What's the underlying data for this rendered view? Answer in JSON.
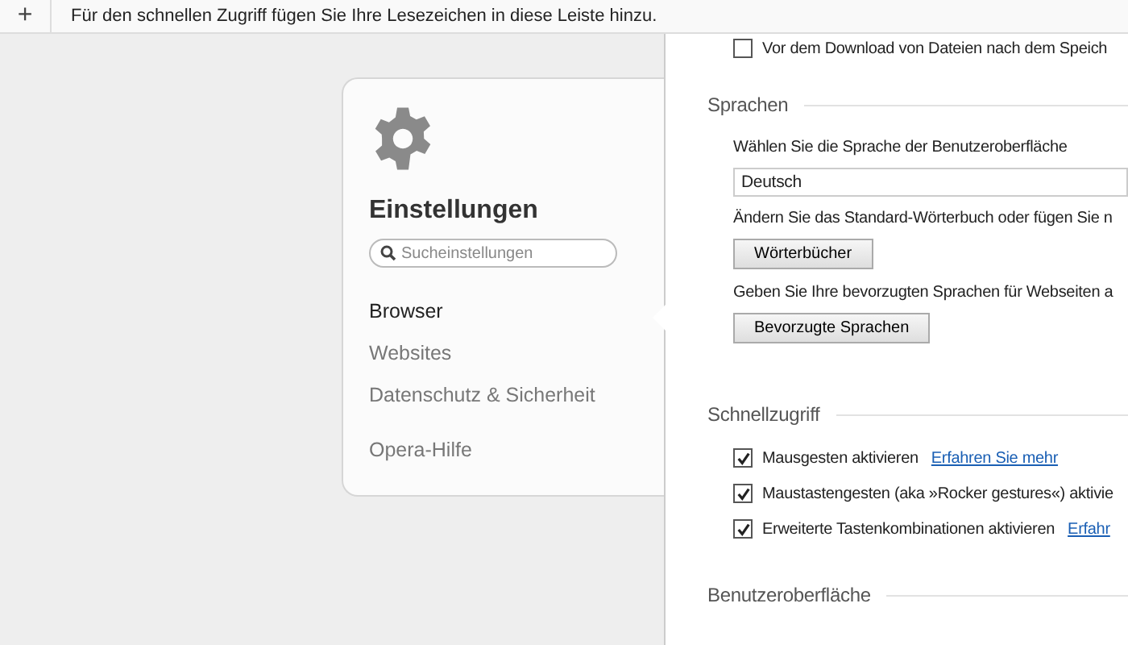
{
  "bookmarks_bar": {
    "add_symbol": "+",
    "hint": "Für den schnellen Zugriff fügen Sie Ihre Lesezeichen in diese Leiste hinzu."
  },
  "sidebar": {
    "title": "Einstellungen",
    "search": {
      "placeholder": "Sucheinstellungen"
    },
    "items": [
      {
        "label": "Browser",
        "selected": true
      },
      {
        "label": "Websites",
        "selected": false
      },
      {
        "label": "Datenschutz & Sicherheit",
        "selected": false
      }
    ],
    "help": "Opera-Hilfe"
  },
  "top_option": {
    "label": "Vor dem Download von Dateien nach dem Speich",
    "checked": false
  },
  "sections": [
    {
      "title": "Sprachen",
      "rows": [
        {
          "kind": "text",
          "text": "Wählen Sie die Sprache der Benutzeroberfläche"
        },
        {
          "kind": "select",
          "value": "Deutsch"
        },
        {
          "kind": "text",
          "text": "Ändern Sie das Standard-Wörterbuch oder fügen Sie n"
        },
        {
          "kind": "button",
          "label": "Wörterbücher"
        },
        {
          "kind": "text",
          "text": "Geben Sie Ihre bevorzugten Sprachen für Webseiten a"
        },
        {
          "kind": "button",
          "label": "Bevorzugte Sprachen"
        }
      ]
    },
    {
      "title": "Schnellzugriff",
      "rows": [
        {
          "kind": "checkbox",
          "label": "Mausgesten aktivieren",
          "checked": true,
          "link": "Erfahren Sie mehr"
        },
        {
          "kind": "checkbox",
          "label": "Maustastengesten (aka »Rocker gestures«) aktivie",
          "checked": true
        },
        {
          "kind": "checkbox",
          "label": "Erweiterte Tastenkombinationen aktivieren",
          "checked": true,
          "link": "Erfahr"
        }
      ]
    },
    {
      "title": "Benutzeroberfläche"
    }
  ]
}
